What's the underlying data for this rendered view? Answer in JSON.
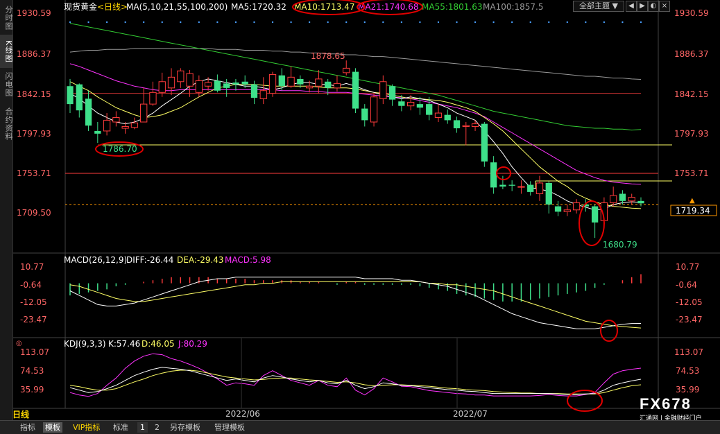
{
  "sidebar": {
    "tabs": [
      {
        "label": "分时图",
        "active": false
      },
      {
        "label": "K线图",
        "active": true
      },
      {
        "label": "闪电图",
        "active": false
      },
      {
        "label": "合约资料",
        "active": false
      }
    ]
  },
  "header": {
    "symbol": "现货黄金",
    "period": "<日线>",
    "ma_label": "MA(5,10,21,55,100,200)",
    "ma5": "MA5:1720.32",
    "ma10": "MA10:1713.47",
    "ma21": "MA21:1740.68",
    "ma55": "MA55:1801.63",
    "ma100": "MA100:1857.5",
    "theme_button": "全部主题",
    "theme_arrow": "▼"
  },
  "price_axis": {
    "ticks": [
      "1930.59",
      "1886.37",
      "1842.15",
      "1797.93",
      "1753.71",
      "1709.50"
    ],
    "current": "1719.34"
  },
  "annotations": {
    "high": "1878.65",
    "low_left": "1786.70",
    "low_right": "1680.79"
  },
  "macd": {
    "label": "MACD(26,12,9)",
    "diff": "DIFF:-26.44",
    "dea": "DEA:-29.43",
    "macd": "MACD:5.98",
    "ticks": [
      "10.77",
      "-0.64",
      "-12.05",
      "-23.47"
    ]
  },
  "kdj": {
    "label": "KDJ(9,3,3)",
    "k": "K:57.46",
    "d": "D:46.05",
    "j": "J:80.29",
    "ticks": [
      "113.07",
      "74.53",
      "35.99"
    ]
  },
  "dates": [
    "2022/06",
    "2022/07"
  ],
  "bottom": {
    "day_label": "日线",
    "tabs": [
      "指标",
      "模板",
      "VIP指标",
      "标准",
      "1",
      "2",
      "另存模板",
      "管理模板"
    ],
    "active_tab": "模板"
  },
  "watermark": {
    "big": "FX678",
    "small": "汇通网 | 金融财经门户"
  },
  "colors": {
    "up": "#ff3b3b",
    "down": "#3ee08a",
    "ma5": "#ffffff",
    "ma10": "#ffff66",
    "ma21": "#ff33ff",
    "ma55": "#33cc33",
    "ma100": "#999999",
    "circle": "#e00000"
  },
  "chart_data": {
    "type": "candlestick",
    "candles": [
      [
        1850,
        1830,
        1858,
        1820
      ],
      [
        1852,
        1823,
        1853,
        1815
      ],
      [
        1836,
        1806,
        1845,
        1800
      ],
      [
        1800,
        1797,
        1810,
        1786.7
      ],
      [
        1800,
        1812,
        1820,
        1795
      ],
      [
        1810,
        1815,
        1822,
        1805
      ],
      [
        1803,
        1805,
        1810,
        1797
      ],
      [
        1804,
        1809,
        1815,
        1802
      ],
      [
        1810,
        1830,
        1848,
        1810
      ],
      [
        1830,
        1843,
        1855,
        1828
      ],
      [
        1843,
        1855,
        1865,
        1838
      ],
      [
        1848,
        1860,
        1870,
        1840
      ],
      [
        1855,
        1867,
        1870,
        1848
      ],
      [
        1850,
        1864,
        1868,
        1838
      ],
      [
        1843,
        1856,
        1862,
        1838
      ],
      [
        1850,
        1854,
        1860,
        1845
      ],
      [
        1856,
        1845,
        1863,
        1843
      ],
      [
        1853,
        1848,
        1858,
        1838
      ],
      [
        1854,
        1852,
        1858,
        1845
      ],
      [
        1855,
        1852,
        1862,
        1848
      ],
      [
        1852,
        1837,
        1856,
        1830
      ],
      [
        1836,
        1845,
        1860,
        1830
      ],
      [
        1842,
        1863,
        1866,
        1838
      ],
      [
        1862,
        1850,
        1870,
        1845
      ],
      [
        1850,
        1860,
        1872,
        1848
      ],
      [
        1858,
        1852,
        1862,
        1848
      ],
      [
        1848,
        1850,
        1856,
        1843
      ],
      [
        1850,
        1858,
        1868,
        1842
      ],
      [
        1855,
        1848,
        1858,
        1840
      ],
      [
        1848,
        1853,
        1862,
        1844
      ],
      [
        1865,
        1870,
        1878.65,
        1862
      ],
      [
        1866,
        1825,
        1870,
        1820
      ],
      [
        1825,
        1812,
        1830,
        1805
      ],
      [
        1810,
        1838,
        1842,
        1805
      ],
      [
        1836,
        1855,
        1862,
        1830
      ],
      [
        1850,
        1835,
        1852,
        1828
      ],
      [
        1833,
        1828,
        1840,
        1822
      ],
      [
        1828,
        1832,
        1840,
        1823
      ],
      [
        1830,
        1826,
        1838,
        1818
      ],
      [
        1830,
        1818,
        1838,
        1812
      ],
      [
        1815,
        1820,
        1830,
        1810
      ],
      [
        1818,
        1812,
        1824,
        1808
      ],
      [
        1812,
        1803,
        1816,
        1798
      ],
      [
        1805,
        1806,
        1810,
        1784
      ],
      [
        1805,
        1808,
        1812,
        1800
      ],
      [
        1808,
        1766,
        1810,
        1760
      ],
      [
        1765,
        1737,
        1772,
        1730
      ],
      [
        1740,
        1738,
        1750,
        1735
      ],
      [
        1740,
        1739,
        1745,
        1733
      ],
      [
        1738,
        1738,
        1745,
        1730
      ],
      [
        1740,
        1732,
        1744,
        1728
      ],
      [
        1730,
        1742,
        1750,
        1722
      ],
      [
        1742,
        1718,
        1744,
        1708
      ],
      [
        1716,
        1710,
        1722,
        1705
      ],
      [
        1710,
        1712,
        1718,
        1705
      ],
      [
        1712,
        1720,
        1724,
        1708
      ],
      [
        1718,
        1716,
        1724,
        1710
      ],
      [
        1716,
        1698,
        1718,
        1680.79
      ],
      [
        1700,
        1720,
        1726,
        1695
      ],
      [
        1720,
        1728,
        1738,
        1716
      ],
      [
        1730,
        1722,
        1734,
        1718
      ],
      [
        1722,
        1726,
        1730,
        1718
      ],
      [
        1722,
        1719.34,
        1726,
        1716
      ]
    ],
    "ma5": [
      1842,
      1836,
      1828,
      1820,
      1815,
      1810,
      1808,
      1810,
      1814,
      1820,
      1828,
      1835,
      1842,
      1850,
      1855,
      1858,
      1856,
      1854,
      1852,
      1850,
      1850,
      1848,
      1846,
      1848,
      1852,
      1854,
      1854,
      1852,
      1852,
      1850,
      1853,
      1850,
      1846,
      1843,
      1840,
      1838,
      1836,
      1838,
      1836,
      1834,
      1830,
      1826,
      1820,
      1816,
      1812,
      1800,
      1788,
      1775,
      1760,
      1748,
      1737,
      1735,
      1733,
      1728,
      1722,
      1718,
      1715,
      1712,
      1713,
      1718,
      1720,
      1721,
      1720.32
    ],
    "ma10": [
      1855,
      1850,
      1845,
      1838,
      1832,
      1826,
      1822,
      1818,
      1815,
      1816,
      1818,
      1822,
      1826,
      1832,
      1838,
      1843,
      1848,
      1850,
      1852,
      1852,
      1852,
      1851,
      1850,
      1850,
      1850,
      1850,
      1850,
      1849,
      1848,
      1848,
      1848,
      1847,
      1845,
      1843,
      1842,
      1840,
      1838,
      1836,
      1836,
      1835,
      1834,
      1832,
      1829,
      1826,
      1822,
      1815,
      1808,
      1800,
      1790,
      1780,
      1770,
      1760,
      1752,
      1744,
      1738,
      1730,
      1725,
      1721,
      1718,
      1716,
      1715,
      1714,
      1713.47
    ],
    "ma21": [
      1875,
      1872,
      1868,
      1864,
      1860,
      1856,
      1853,
      1850,
      1848,
      1846,
      1845,
      1845,
      1846,
      1846,
      1846,
      1846,
      1846,
      1846,
      1846,
      1846,
      1846,
      1846,
      1846,
      1845,
      1845,
      1845,
      1844,
      1844,
      1843,
      1843,
      1843,
      1842,
      1841,
      1840,
      1839,
      1838,
      1837,
      1836,
      1834,
      1832,
      1830,
      1828,
      1826,
      1823,
      1820,
      1816,
      1810,
      1804,
      1798,
      1792,
      1786,
      1780,
      1774,
      1768,
      1762,
      1756,
      1752,
      1748,
      1745,
      1743,
      1742,
      1741,
      1740.68
    ],
    "ma55": [
      1920,
      1918,
      1916,
      1914,
      1912,
      1910,
      1908,
      1906,
      1904,
      1902,
      1900,
      1898,
      1896,
      1894,
      1892,
      1890,
      1888,
      1886,
      1884,
      1882,
      1880,
      1878,
      1876,
      1874,
      1872,
      1870,
      1868,
      1866,
      1864,
      1862,
      1860,
      1858,
      1856,
      1854,
      1852,
      1850,
      1848,
      1846,
      1844,
      1842,
      1840,
      1837,
      1834,
      1831,
      1828,
      1825,
      1822,
      1820,
      1818,
      1816,
      1814,
      1812,
      1810,
      1808,
      1806,
      1805,
      1804,
      1803,
      1803,
      1802,
      1802,
      1801,
      1801.63
    ],
    "ma100": [
      1888,
      1889,
      1890,
      1890,
      1891,
      1891,
      1891,
      1892,
      1892,
      1892,
      1892,
      1892,
      1892,
      1892,
      1892,
      1892,
      1891,
      1891,
      1891,
      1890,
      1890,
      1890,
      1889,
      1889,
      1888,
      1888,
      1887,
      1887,
      1886,
      1886,
      1885,
      1885,
      1884,
      1883,
      1883,
      1882,
      1881,
      1880,
      1879,
      1878,
      1877,
      1876,
      1875,
      1874,
      1873,
      1872,
      1871,
      1870,
      1869,
      1868,
      1867,
      1866,
      1865,
      1864,
      1863,
      1862,
      1861,
      1861,
      1860,
      1859,
      1859,
      1858,
      1857.5
    ],
    "ma200": [
      1842,
      1842,
      1842,
      1842,
      1842,
      1842,
      1842,
      1842,
      1842,
      1842,
      1842,
      1842,
      1842,
      1842,
      1842,
      1842,
      1842,
      1842,
      1842,
      1842,
      1842,
      1842,
      1842,
      1842,
      1842,
      1842,
      1842,
      1842,
      1842,
      1842,
      1842,
      1842,
      1842,
      1842,
      1842,
      1842,
      1842,
      1842,
      1842,
      1842,
      1842,
      1842,
      1842,
      1842,
      1842,
      1842,
      1842,
      1842,
      1842,
      1842,
      1842,
      1842,
      1842,
      1842,
      1842,
      1842,
      1842,
      1842,
      1842,
      1842,
      1842,
      1842,
      1842
    ],
    "macd_hist": [
      -8,
      -7,
      -6,
      -5,
      -4,
      -2,
      -1,
      0,
      1,
      2,
      3,
      4,
      4,
      4,
      4,
      4,
      3,
      3,
      3,
      3,
      2,
      2,
      2,
      2,
      2,
      1,
      1,
      1,
      0,
      -1,
      1,
      1,
      -1,
      -1,
      -1,
      -1,
      -1,
      -1,
      -2,
      -3,
      -4,
      -5,
      -7,
      -8,
      -9,
      -10,
      -11,
      -12,
      -12,
      -12,
      -11,
      -10,
      -9,
      -8,
      -7,
      -6,
      -5,
      -3,
      -1,
      0,
      2,
      4,
      5.98
    ],
    "diff": [
      -5,
      -8,
      -11,
      -14,
      -15,
      -15,
      -14,
      -13,
      -11,
      -9,
      -7,
      -5,
      -3,
      -1,
      1,
      2,
      3,
      3,
      4,
      4,
      4,
      4,
      4,
      4,
      4,
      4,
      4,
      4,
      4,
      4,
      4,
      4,
      3,
      3,
      3,
      3,
      2,
      2,
      1,
      0,
      -1,
      -2,
      -4,
      -6,
      -8,
      -11,
      -14,
      -17,
      -20,
      -22,
      -24,
      -26,
      -27,
      -28,
      -29,
      -30,
      -30,
      -30,
      -29,
      -28,
      -27,
      -26.5,
      -26.44
    ],
    "dea": [
      -1,
      -2,
      -4,
      -6,
      -8,
      -10,
      -11,
      -12,
      -12,
      -11,
      -10,
      -9,
      -8,
      -7,
      -6,
      -5,
      -4,
      -3,
      -2,
      -1,
      -1,
      0,
      0,
      1,
      1,
      1,
      1,
      1,
      1,
      1,
      1,
      1,
      1,
      1,
      1,
      1,
      1,
      1,
      1,
      0,
      0,
      -1,
      -1,
      -2,
      -3,
      -4,
      -5,
      -7,
      -9,
      -11,
      -13,
      -15,
      -17,
      -19,
      -21,
      -23,
      -25,
      -26,
      -27,
      -28,
      -28.5,
      -29,
      -29.43
    ],
    "k": [
      40,
      35,
      30,
      32,
      38,
      45,
      55,
      65,
      72,
      78,
      82,
      80,
      78,
      75,
      70,
      65,
      60,
      55,
      58,
      55,
      52,
      60,
      65,
      62,
      58,
      55,
      52,
      55,
      50,
      48,
      55,
      45,
      38,
      42,
      50,
      48,
      45,
      44,
      42,
      40,
      38,
      36,
      35,
      33,
      32,
      30,
      28,
      28,
      28,
      28,
      28,
      28,
      28,
      27,
      26,
      26,
      27,
      28,
      35,
      45,
      50,
      54,
      57.46
    ],
    "d": [
      45,
      42,
      38,
      35,
      35,
      38,
      45,
      52,
      58,
      65,
      70,
      74,
      76,
      76,
      74,
      70,
      66,
      62,
      60,
      58,
      56,
      57,
      59,
      60,
      60,
      58,
      56,
      55,
      53,
      51,
      52,
      50,
      46,
      44,
      45,
      46,
      46,
      45,
      44,
      43,
      41,
      39,
      38,
      36,
      35,
      34,
      32,
      31,
      30,
      29,
      29,
      28,
      28,
      28,
      27,
      27,
      27,
      27,
      30,
      35,
      40,
      44,
      46.05
    ],
    "j": [
      30,
      25,
      22,
      28,
      45,
      60,
      80,
      95,
      105,
      110,
      108,
      100,
      95,
      88,
      80,
      70,
      58,
      45,
      50,
      48,
      45,
      65,
      75,
      65,
      55,
      50,
      45,
      55,
      45,
      42,
      60,
      35,
      25,
      38,
      60,
      52,
      43,
      42,
      38,
      34,
      32,
      30,
      28,
      27,
      25,
      25,
      23,
      23,
      23,
      23,
      23,
      24,
      26,
      24,
      23,
      23,
      26,
      30,
      50,
      68,
      75,
      78,
      80.29
    ]
  }
}
